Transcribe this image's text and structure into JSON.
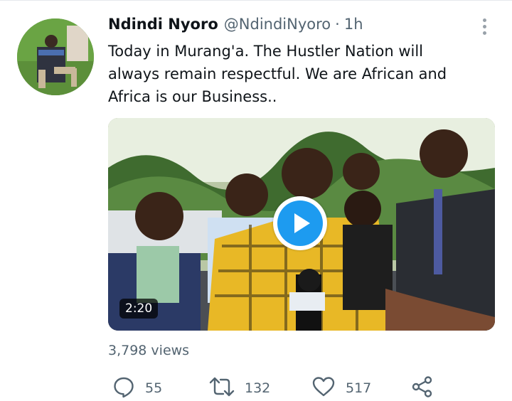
{
  "tweet": {
    "display_name": "Ndindi Nyoro",
    "handle": "@NdindiNyoro",
    "separator": "·",
    "time": "1h",
    "text": "Today in Murang'a. The Hustler Nation will\nalways remain respectful. We are African and\nAfrica is our Business..",
    "video_duration": "2:20",
    "views": "3,798 views"
  },
  "actions": {
    "reply_count": "55",
    "retweet_count": "132",
    "like_count": "517"
  },
  "icons": {
    "more": "more-vertical-icon",
    "reply": "reply-icon",
    "retweet": "retweet-icon",
    "like": "heart-icon",
    "share": "share-icon",
    "play": "play-icon"
  },
  "colors": {
    "accent": "#1d9bf0",
    "text_primary": "#0f1419",
    "text_secondary": "#536471"
  }
}
